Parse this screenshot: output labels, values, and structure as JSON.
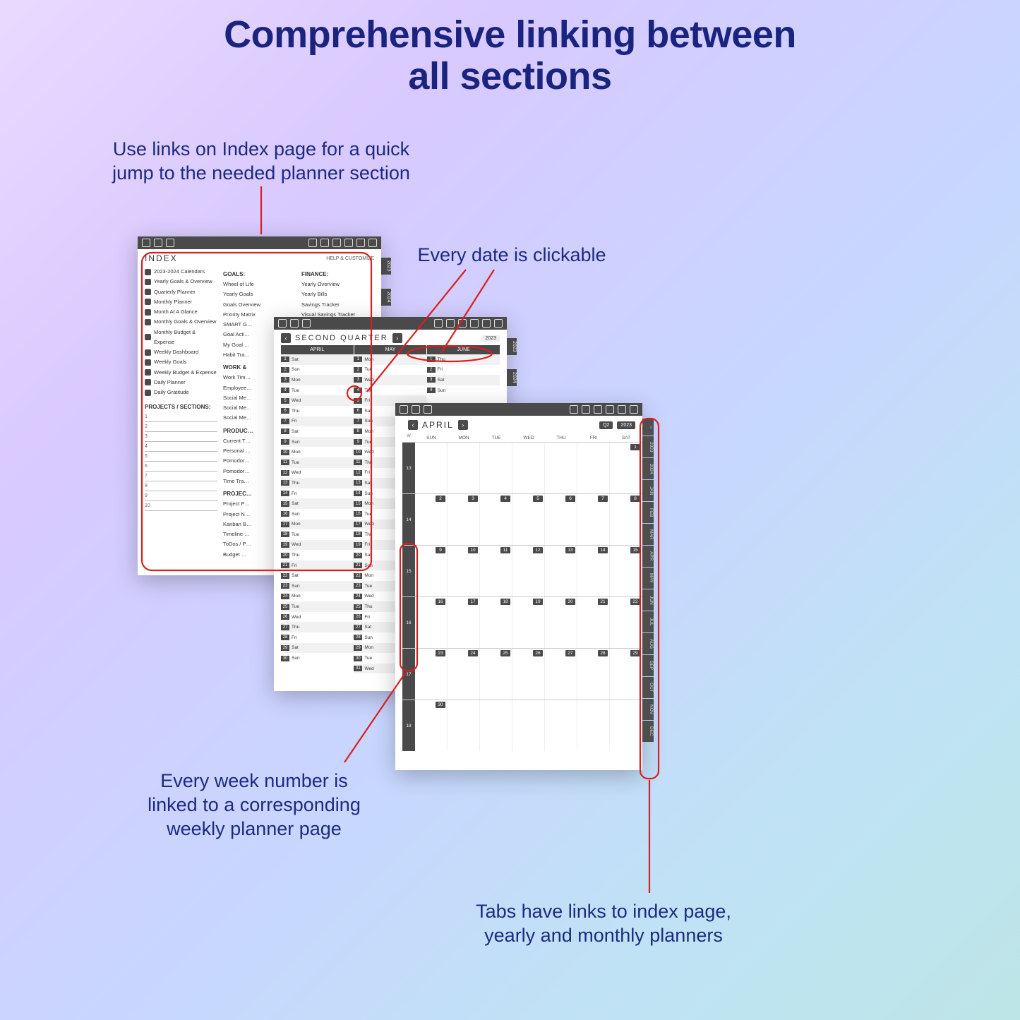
{
  "title_l1": "Comprehensive linking between",
  "title_l2": "all sections",
  "captions": {
    "index_l1": "Use links on Index page for a quick",
    "index_l2": "jump to the needed planner section",
    "date": "Every date is clickable",
    "week_l1": "Every week number is",
    "week_l2": "linked to a corresponding",
    "week_l3": "weekly planner page",
    "tabs_l1": "Tabs have links to index page,",
    "tabs_l2": "yearly and monthly planners"
  },
  "index": {
    "title": "INDEX",
    "help": "HELP & CUSTOMIZE",
    "side": [
      "2023",
      "2024"
    ],
    "left": [
      "2023-2024 Calendars",
      "Yearly Goals & Overview",
      "Quarterly Planner",
      "Monthly Planner",
      "Month At A Glance",
      "Monthly Goals & Overview",
      "Monthly Budget & Expense",
      "Weekly Dashboard",
      "Weekly Goals",
      "Weekly Budget & Expense",
      "Daily Planner",
      "Daily Gratitude"
    ],
    "left_header": "PROJECTS / SECTIONS:",
    "nums": [
      "1",
      "2",
      "3",
      "4",
      "5",
      "6",
      "7",
      "8",
      "9",
      "10"
    ],
    "col2_header": "GOALS:",
    "col2": [
      "Wheel of Life",
      "Yearly Goals",
      "Goals Overview",
      "Priority Matrix",
      "SMART G…",
      "Goal Acti…",
      "My Goal …",
      "Habit Tra…"
    ],
    "col2b_header": "WORK &",
    "col2b": [
      "Work Tim…",
      "Employee…",
      "Social Me…",
      "Social Me…",
      "Social Me…"
    ],
    "col2c_header": "PRODUC…",
    "col2c": [
      "Current T…",
      "Personal …",
      "Pomodor…",
      "Pomodor…",
      "Time Tra…"
    ],
    "col2d_header": "PROJEC…",
    "col2d": [
      "Project P…",
      "Project N…",
      "Kanban B…",
      "Timeline …",
      "ToDos / P…",
      "Budget …"
    ],
    "col3_header": "FINANCE:",
    "col3": [
      "Yearly Overview",
      "Yearly Bills",
      "Savings Tracker",
      "Visual Savings Tracker"
    ]
  },
  "quarter": {
    "title": "SECOND QUARTER",
    "year": "2023",
    "months": [
      "APRIL",
      "MAY",
      "JUNE"
    ],
    "side": [
      "2023",
      "2024"
    ],
    "col1": [
      [
        "1",
        "Sat"
      ],
      [
        "2",
        "Sun"
      ],
      [
        "3",
        "Mon"
      ],
      [
        "4",
        "Tue"
      ],
      [
        "5",
        "Wed"
      ],
      [
        "6",
        "Thu"
      ],
      [
        "7",
        "Fri"
      ],
      [
        "8",
        "Sat"
      ],
      [
        "9",
        "Sun"
      ],
      [
        "10",
        "Mon"
      ],
      [
        "11",
        "Tue"
      ],
      [
        "12",
        "Wed"
      ],
      [
        "13",
        "Thu"
      ],
      [
        "14",
        "Fri"
      ],
      [
        "15",
        "Sat"
      ],
      [
        "16",
        "Sun"
      ],
      [
        "17",
        "Mon"
      ],
      [
        "18",
        "Tue"
      ],
      [
        "19",
        "Wed"
      ],
      [
        "20",
        "Thu"
      ],
      [
        "21",
        "Fri"
      ],
      [
        "22",
        "Sat"
      ],
      [
        "23",
        "Sun"
      ],
      [
        "24",
        "Mon"
      ],
      [
        "25",
        "Tue"
      ],
      [
        "26",
        "Wed"
      ],
      [
        "27",
        "Thu"
      ],
      [
        "28",
        "Fri"
      ],
      [
        "29",
        "Sat"
      ],
      [
        "30",
        "Sun"
      ]
    ],
    "col2": [
      [
        "1",
        "Mon"
      ],
      [
        "2",
        "Tue"
      ],
      [
        "3",
        "Wed"
      ],
      [
        "4",
        "Thu"
      ],
      [
        "5",
        "Fri"
      ],
      [
        "6",
        "Sat"
      ],
      [
        "7",
        "Sun"
      ],
      [
        "8",
        "Mon"
      ],
      [
        "9",
        "Tue"
      ],
      [
        "10",
        "Wed"
      ],
      [
        "11",
        "Thu"
      ],
      [
        "12",
        "Fri"
      ],
      [
        "13",
        "Sat"
      ],
      [
        "14",
        "Sun"
      ],
      [
        "15",
        "Mon"
      ],
      [
        "16",
        "Tue"
      ],
      [
        "17",
        "Wed"
      ],
      [
        "18",
        "Thu"
      ],
      [
        "19",
        "Fri"
      ],
      [
        "20",
        "Sat"
      ],
      [
        "21",
        "Sun"
      ],
      [
        "22",
        "Mon"
      ],
      [
        "23",
        "Tue"
      ],
      [
        "24",
        "Wed"
      ],
      [
        "25",
        "Thu"
      ],
      [
        "26",
        "Fri"
      ],
      [
        "27",
        "Sat"
      ],
      [
        "28",
        "Sun"
      ],
      [
        "29",
        "Mon"
      ],
      [
        "30",
        "Tue"
      ],
      [
        "31",
        "Wed"
      ]
    ],
    "col3": [
      [
        "1",
        "Thu"
      ],
      [
        "2",
        "Fri"
      ],
      [
        "3",
        "Sat"
      ],
      [
        "4",
        "Sun"
      ]
    ]
  },
  "month": {
    "title": "APRIL",
    "q": "Q2",
    "year": "2023",
    "wdays": [
      "W",
      "SUN",
      "MON",
      "TUE",
      "WED",
      "THU",
      "FRI",
      "SAT"
    ],
    "side": [
      "⌂",
      "2023",
      "2024",
      "JAN",
      "FEB",
      "MAR",
      "APR",
      "MAY",
      "JUN",
      "JUL",
      "AUG",
      "SEP",
      "OCT",
      "NOV",
      "DEC"
    ],
    "rows": [
      {
        "w": "13",
        "days": [
          [
            "",
            1
          ],
          [
            "",
            1
          ],
          [
            "",
            1
          ],
          [
            "",
            1
          ],
          [
            "",
            1
          ],
          [
            "",
            1
          ],
          [
            "1",
            0
          ]
        ]
      },
      {
        "w": "14",
        "days": [
          [
            "2",
            0
          ],
          [
            "3",
            0
          ],
          [
            "4",
            0
          ],
          [
            "5",
            0
          ],
          [
            "6",
            0
          ],
          [
            "7",
            0
          ],
          [
            "8",
            0
          ]
        ]
      },
      {
        "w": "15",
        "days": [
          [
            "9",
            0
          ],
          [
            "10",
            0
          ],
          [
            "11",
            0
          ],
          [
            "12",
            0
          ],
          [
            "13",
            0
          ],
          [
            "14",
            0
          ],
          [
            "15",
            0
          ]
        ]
      },
      {
        "w": "16",
        "days": [
          [
            "16",
            0
          ],
          [
            "17",
            0
          ],
          [
            "18",
            0
          ],
          [
            "19",
            0
          ],
          [
            "20",
            0
          ],
          [
            "21",
            0
          ],
          [
            "22",
            0
          ]
        ]
      },
      {
        "w": "17",
        "days": [
          [
            "23",
            0
          ],
          [
            "24",
            0
          ],
          [
            "25",
            0
          ],
          [
            "26",
            0
          ],
          [
            "27",
            0
          ],
          [
            "28",
            0
          ],
          [
            "29",
            0
          ]
        ]
      },
      {
        "w": "18",
        "days": [
          [
            "30",
            0
          ],
          [
            "",
            1
          ],
          [
            "",
            1
          ],
          [
            "",
            1
          ],
          [
            "",
            1
          ],
          [
            "",
            1
          ],
          [
            "",
            1
          ]
        ]
      }
    ]
  }
}
